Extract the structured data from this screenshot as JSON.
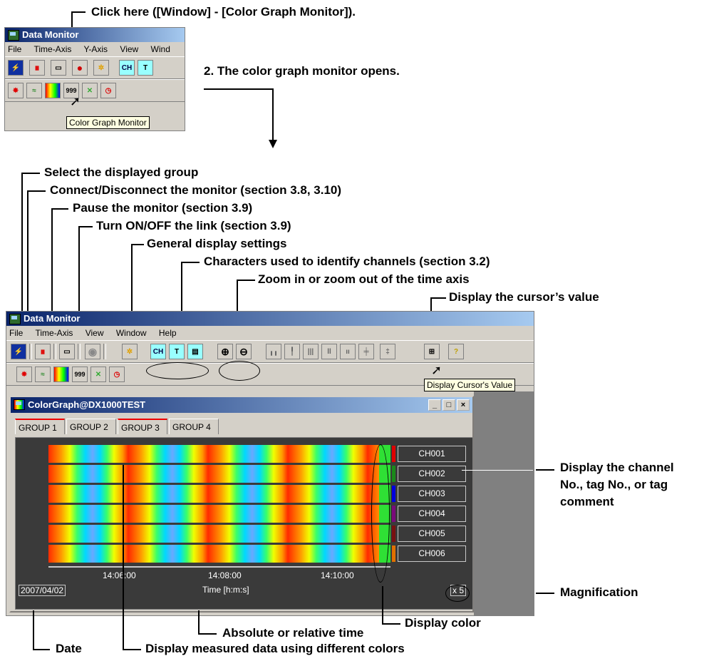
{
  "annotations": {
    "click_here": "Click here ([Window] - [Color Graph Monitor]).",
    "opens": "2. The color graph monitor opens.",
    "select_group": "Select the displayed group",
    "connect": "Connect/Disconnect the monitor (section 3.8, 3.10)",
    "pause": "Pause the monitor (section 3.9)",
    "link": "Turn ON/OFF the link (section 3.9)",
    "general": "General display settings",
    "characters": "Characters used to identify channels (section 3.2)",
    "zoom": "Zoom in or zoom out of the time axis",
    "cursor_value": "Display the cursor’s value",
    "display_channel_1": "Display the channel",
    "display_channel_2": "No., tag No., or tag",
    "display_channel_3": "comment",
    "magnification": "Magnification",
    "display_color": "Display color",
    "abs_time": "Absolute or relative time",
    "date": "Date",
    "measured": "Display measured data using different colors"
  },
  "top_window": {
    "title": "Data Monitor",
    "menu": [
      "File",
      "Time-Axis",
      "Y-Axis",
      "View",
      "Wind"
    ],
    "tooltip": "Color Graph Monitor"
  },
  "main_window": {
    "title": "Data Monitor",
    "menu": [
      "File",
      "Time-Axis",
      "View",
      "Window",
      "Help"
    ],
    "tooltip": "Display Cursor's Value",
    "child_title": "ColorGraph@DX1000TEST",
    "tabs": [
      "GROUP 1",
      "GROUP 2",
      "GROUP 3",
      "GROUP 4"
    ],
    "channels": [
      "CH001",
      "CH002",
      "CH003",
      "CH004",
      "CH005",
      "CH006"
    ],
    "channel_colors": [
      "#e00000",
      "#1a8a1a",
      "#0000e0",
      "#7a0a7a",
      "#7a1010",
      "#e07000"
    ],
    "time_ticks": [
      "14:06:00",
      "14:08:00",
      "14:10:00"
    ],
    "date": "2007/04/02",
    "time_label": "Time [h:m:s]",
    "magnification": "x 5",
    "winbtns": [
      "_",
      "□",
      "×"
    ]
  }
}
